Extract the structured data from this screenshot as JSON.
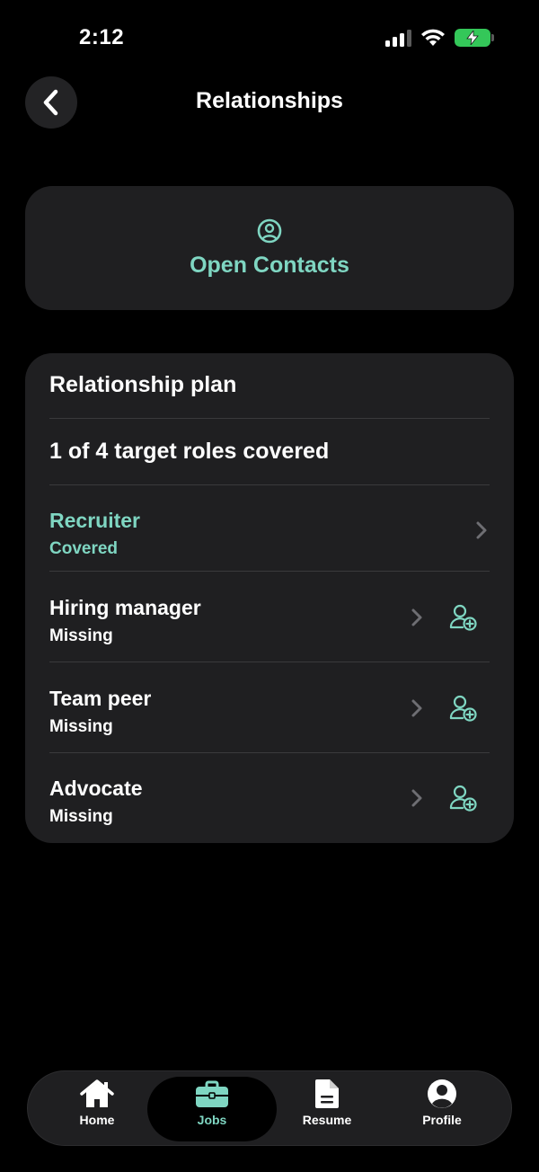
{
  "status_bar": {
    "time": "2:12"
  },
  "header": {
    "title": "Relationships"
  },
  "open_contacts": {
    "label": "Open Contacts"
  },
  "plan": {
    "title": "Relationship plan",
    "summary": "1 of 4 target roles covered",
    "roles": [
      {
        "name": "Recruiter",
        "status": "Covered"
      },
      {
        "name": "Hiring manager",
        "status": "Missing"
      },
      {
        "name": "Team peer",
        "status": "Missing"
      },
      {
        "name": "Advocate",
        "status": "Missing"
      }
    ]
  },
  "tabs": [
    {
      "label": "Home",
      "icon": "home-icon"
    },
    {
      "label": "Jobs",
      "icon": "briefcase-icon",
      "active": true
    },
    {
      "label": "Resume",
      "icon": "document-icon"
    },
    {
      "label": "Profile",
      "icon": "person-circle-icon"
    }
  ],
  "colors": {
    "accent": "#7fd6c2",
    "card": "#1f1f21",
    "background": "#000000",
    "battery": "#34c759"
  }
}
